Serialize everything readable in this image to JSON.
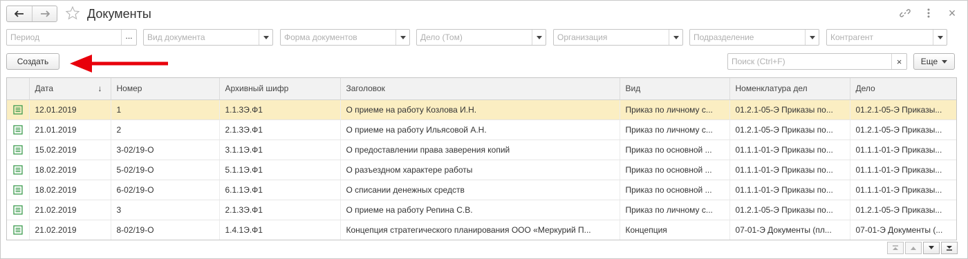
{
  "window": {
    "title": "Документы"
  },
  "titlebar": {
    "icons": [
      "arrow-left-icon",
      "arrow-right-icon",
      "star-icon",
      "link-icon",
      "more-vertical-icon",
      "close-icon"
    ],
    "close_glyph": "×"
  },
  "filters": {
    "period": {
      "placeholder": "Период",
      "button": "..."
    },
    "doc_type": {
      "placeholder": "Вид документа"
    },
    "doc_form": {
      "placeholder": "Форма документов"
    },
    "case": {
      "placeholder": "Дело (Том)"
    },
    "organization": {
      "placeholder": "Организация"
    },
    "department": {
      "placeholder": "Подразделение"
    },
    "counterparty": {
      "placeholder": "Контрагент"
    }
  },
  "toolbar": {
    "create_label": "Создать",
    "search_placeholder": "Поиск (Ctrl+F)",
    "search_clear": "×",
    "more_label": "Еще"
  },
  "colors": {
    "selected_row": "#fbeec2",
    "doc_icon": "#3a9a4c",
    "arrow": "#e8000b"
  },
  "table": {
    "columns": [
      "",
      "Дата",
      "Номер",
      "Архивный шифр",
      "Заголовок",
      "Вид",
      "Номенклатура дел",
      "Дело"
    ],
    "sort_indicator": "↓",
    "rows": [
      [
        "12.01.2019",
        "1",
        "1.1.3Э.Ф1",
        "О приеме на работу Козлова И.Н.",
        "Приказ по личному с...",
        "01.2.1-05-Э Приказы по...",
        "01.2.1-05-Э Приказы..."
      ],
      [
        "21.01.2019",
        "2",
        "2.1.3Э.Ф1",
        "О приеме на работу Ильясовой А.Н.",
        "Приказ по личному с...",
        "01.2.1-05-Э Приказы по...",
        "01.2.1-05-Э Приказы..."
      ],
      [
        "15.02.2019",
        "3-02/19-О",
        "3.1.1Э.Ф1",
        "О предоставлении права заверения копий",
        "Приказ по основной ...",
        "01.1.1-01-Э Приказы по...",
        "01.1.1-01-Э Приказы..."
      ],
      [
        "18.02.2019",
        "5-02/19-О",
        "5.1.1Э.Ф1",
        "О разъездном характере работы",
        "Приказ по основной ...",
        "01.1.1-01-Э Приказы по...",
        "01.1.1-01-Э Приказы..."
      ],
      [
        "18.02.2019",
        "6-02/19-О",
        "6.1.1Э.Ф1",
        "О списании денежных средств",
        "Приказ по основной ...",
        "01.1.1-01-Э Приказы по...",
        "01.1.1-01-Э Приказы..."
      ],
      [
        "21.02.2019",
        "3",
        "2.1.3Э.Ф1",
        "О приеме на работу Репина С.В.",
        "Приказ по личному с...",
        "01.2.1-05-Э Приказы по...",
        "01.2.1-05-Э Приказы..."
      ],
      [
        "21.02.2019",
        "8-02/19-О",
        "1.4.1Э.Ф1",
        "Концепция стратегического планирования ООО «Меркурий П...",
        "Концепция",
        "07-01-Э Документы (пл...",
        "07-01-Э Документы (..."
      ]
    ],
    "selected_row": 0
  },
  "scroll_nav": [
    "first-page-icon",
    "prev-page-icon",
    "next-page-icon",
    "last-page-icon"
  ]
}
